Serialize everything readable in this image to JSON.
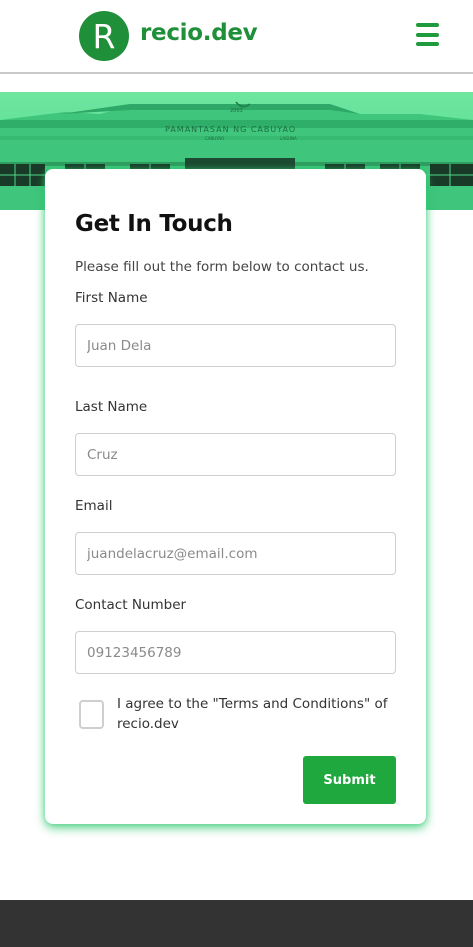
{
  "header": {
    "logo_letter": "R",
    "brand": "recio.dev",
    "menu_icon": "hamburger-menu-icon"
  },
  "hero": {
    "building_sign": "PAMANTASAN NG CABUYAO",
    "building_sub_left": "CABUYAO",
    "building_sub_right": "LAGUNA",
    "building_year": "2003"
  },
  "form": {
    "title": "Get In Touch",
    "subtitle": "Please fill out the form below to contact us.",
    "first_name": {
      "label": "First Name",
      "placeholder": "Juan Dela"
    },
    "last_name": {
      "label": "Last Name",
      "placeholder": "Cruz"
    },
    "email": {
      "label": "Email",
      "placeholder": "juandelacruz@email.com"
    },
    "contact": {
      "label": "Contact Number",
      "placeholder": "09123456789"
    },
    "agree_text": "I agree to the \"Terms and Conditions\" of recio.dev",
    "submit_label": "Submit"
  },
  "colors": {
    "brand_green": "#1f8f3a",
    "button_green": "#1fa83e",
    "hero_green": "#4fd88c",
    "footer_dark": "#333333"
  }
}
